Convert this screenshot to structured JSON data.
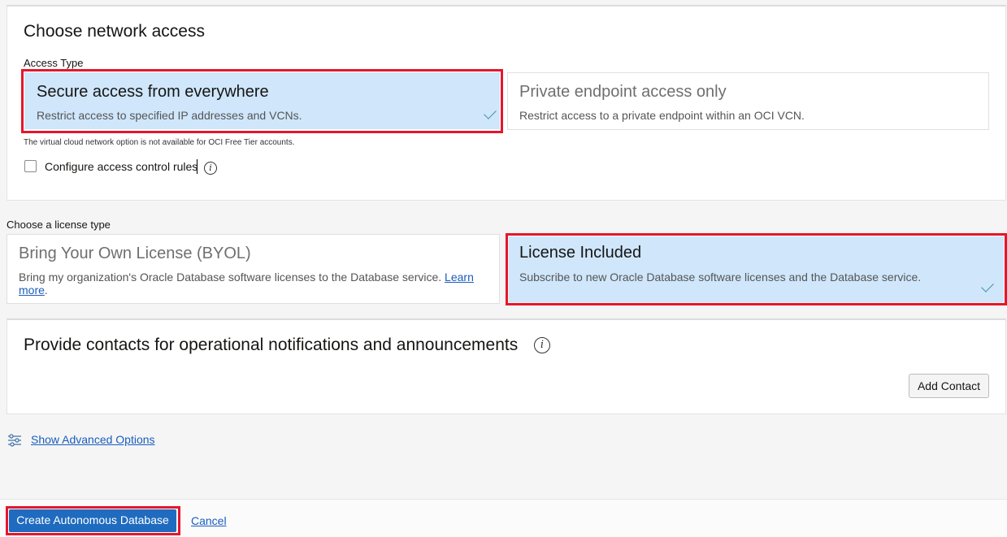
{
  "network": {
    "title": "Choose network access",
    "access_type_label": "Access Type",
    "options": [
      {
        "title": "Secure access from everywhere",
        "desc": "Restrict access to specified IP addresses and VCNs.",
        "selected": true
      },
      {
        "title": "Private endpoint access only",
        "desc": "Restrict access to a private endpoint within an OCI VCN.",
        "selected": false
      }
    ],
    "note": "The virtual cloud network option is not available for OCI Free Tier accounts.",
    "acl_checkbox_label": "Configure access control rules",
    "acl_checked": false
  },
  "license": {
    "label": "Choose a license type",
    "options": [
      {
        "title": "Bring Your Own License (BYOL)",
        "desc": "Bring my organization's Oracle Database software licenses to the Database service.",
        "link1": "Learn",
        "link2": "more",
        "after_link": ".",
        "selected": false
      },
      {
        "title": "License Included",
        "desc": "Subscribe to new Oracle Database software licenses and the Database service.",
        "selected": true
      }
    ]
  },
  "contacts": {
    "title": "Provide contacts for operational notifications and announcements",
    "add_button": "Add Contact"
  },
  "advanced": {
    "link": "Show Advanced Options"
  },
  "footer": {
    "create_button": "Create Autonomous Database",
    "cancel_link": "Cancel"
  },
  "colors": {
    "selected_bg": "#cfe6fb",
    "highlight": "#e5162b",
    "primary": "#1f6bbf",
    "link": "#1a5dbd"
  },
  "icons": [
    "info-icon",
    "checkmark-icon",
    "sliders-icon"
  ]
}
